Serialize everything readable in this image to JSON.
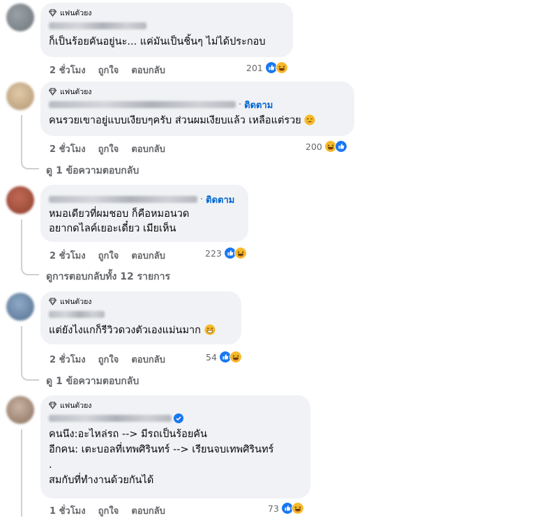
{
  "comments": [
    {
      "badge": "แฟนตัวยง",
      "follow_label": "",
      "lines": [
        "ก็เป็นร้อยคันอยู่นะ... แค่มันเป็นชิ้นๆ ไม่ได้ประกอบ"
      ],
      "time": "2 ชั่วโมง",
      "like": "ถูกใจ",
      "reply": "ตอบกลับ",
      "reaction_count": "201",
      "replies_label": ""
    },
    {
      "badge": "แฟนตัวยง",
      "follow_label": "ติดตาม",
      "lines": [
        "คนรวยเขาอยู่แบบเงียบๆครับ ส่วนผมเงียบแล้ว เหลือแต่รวย"
      ],
      "time": "2 ชั่วโมง",
      "like": "ถูกใจ",
      "reply": "ตอบกลับ",
      "reaction_count": "200",
      "replies_label": "ดู 1 ข้อความตอบกลับ"
    },
    {
      "badge": "",
      "follow_label": "ติดตาม",
      "lines": [
        "หมอเดียวที่ผมชอบ ก็คือหมอนวด",
        "อยากดไลค์เยอะเดี๋ยว เมียเห็น"
      ],
      "time": "2 ชั่วโมง",
      "like": "ถูกใจ",
      "reply": "ตอบกลับ",
      "reaction_count": "223",
      "replies_label": "ดูการตอบกลับทั้ง 12 รายการ"
    },
    {
      "badge": "แฟนตัวยง",
      "follow_label": "",
      "lines": [
        "แต่ยังไงแกก็รีวิวดวงตัวเองแม่นมาก"
      ],
      "time": "2 ชั่วโมง",
      "like": "ถูกใจ",
      "reply": "ตอบกลับ",
      "reaction_count": "54",
      "replies_label": "ดู 1 ข้อความตอบกลับ"
    },
    {
      "badge": "แฟนตัวยง",
      "follow_label": "",
      "lines": [
        "คนนึง:อะไหล่รถ --> มีรถเป็นร้อยคัน",
        "อีกคน: เตะบอลที่เทพศิรินทร์ --> เรียนจบเทพศิรินทร์",
        ".",
        "สมกับที่ทำงานด้วยกันได้"
      ],
      "time": "1 ชั่วโมง",
      "like": "ถูกใจ",
      "reply": "ตอบกลับ",
      "reaction_count": "73",
      "replies_label": ""
    }
  ],
  "colors": {
    "bubble": "#f0f2f5",
    "meta_text": "#65676b",
    "link_blue": "#0064d1",
    "like_blue": "#1877f2",
    "haha_yellow": "#f7b928"
  },
  "icons": [
    "diamond-icon",
    "like-reaction-icon",
    "haha-reaction-icon",
    "verified-badge-icon",
    "smile-emoji-icon"
  ]
}
